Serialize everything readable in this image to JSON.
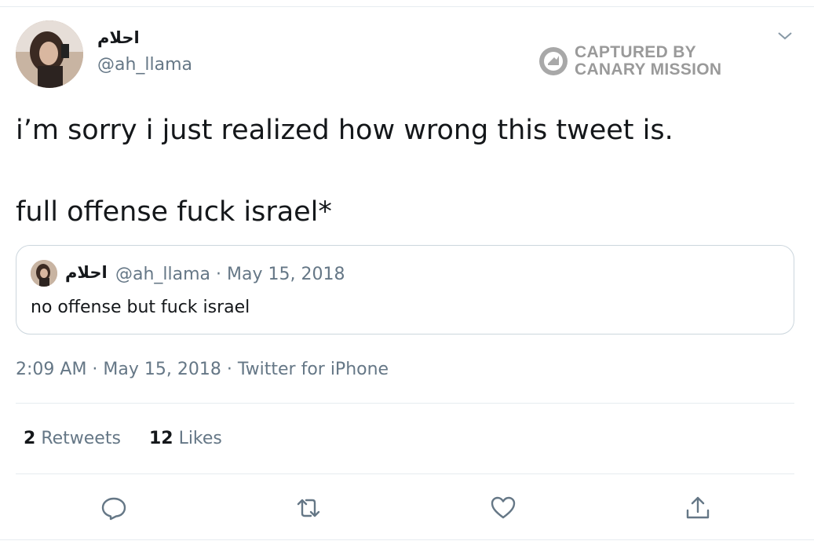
{
  "author": {
    "display_name": "احلام",
    "handle": "@ah_llama"
  },
  "watermark": {
    "line1": "CAPTURED BY",
    "line2": "CANARY MISSION"
  },
  "tweet": {
    "line1": "i’m sorry i just realized how wrong this tweet is.",
    "line2": "full offense fuck israel*"
  },
  "quoted_tweet": {
    "display_name": "احلام",
    "meta": "@ah_llama · May 15, 2018",
    "text": "no offense but fuck israel"
  },
  "timestamp": {
    "time_date": "2:09 AM · May 15, 2018 · ",
    "source": "Twitter for iPhone"
  },
  "stats": {
    "retweets_count": "2",
    "retweets_label": "Retweets",
    "likes_count": "12",
    "likes_label": "Likes"
  },
  "icons": {
    "reply": "reply-icon",
    "retweet": "retweet-icon",
    "like": "heart-icon",
    "share": "share-icon",
    "more": "chevron-down-icon"
  },
  "colors": {
    "text_primary": "#14171a",
    "text_secondary": "#657786",
    "divider": "#e6ecf0",
    "watermark": "#9a9a9a"
  }
}
